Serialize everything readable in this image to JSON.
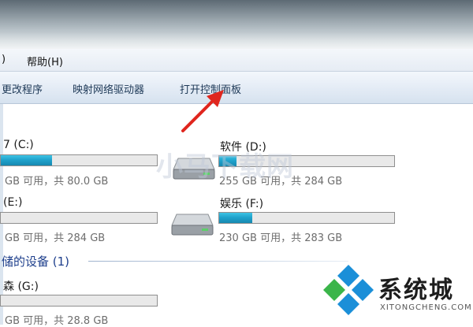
{
  "menu": {
    "partial_left": ")",
    "help": "帮助(H)"
  },
  "command_bar": {
    "change_program": "更改程序",
    "map_network_drive": "映射网络驱动器",
    "open_control_panel": "打开控制面板"
  },
  "drives": [
    {
      "id": "c",
      "label": "7 (C:)",
      "info": "GB 可用，共 80.0 GB",
      "usage": 0.33
    },
    {
      "id": "d",
      "label": "软件 (D:)",
      "info": "255 GB 可用，共 284 GB",
      "usage": 0.1
    },
    {
      "id": "e",
      "label": "(E:)",
      "info": "GB 可用，共 284 GB",
      "usage": 0.0
    },
    {
      "id": "f",
      "label": "娱乐 (F:)",
      "info": "230 GB 可用，共 283 GB",
      "usage": 0.19
    },
    {
      "id": "g",
      "label": "森 (G:)",
      "info": "GB 可用，共 28.8 GB",
      "usage": 0.0
    }
  ],
  "section": {
    "removable": "储的设备 (1)"
  },
  "watermark": "小马下载网",
  "logo": {
    "text": "系统城",
    "sub": "XITONGCHENG.COM"
  },
  "colors": {
    "accent": "#1f9fca",
    "section": "#1e3f8c",
    "arrow": "#e0261e",
    "logo_blue": "#1b8fd8",
    "logo_green": "#3bb54a"
  }
}
